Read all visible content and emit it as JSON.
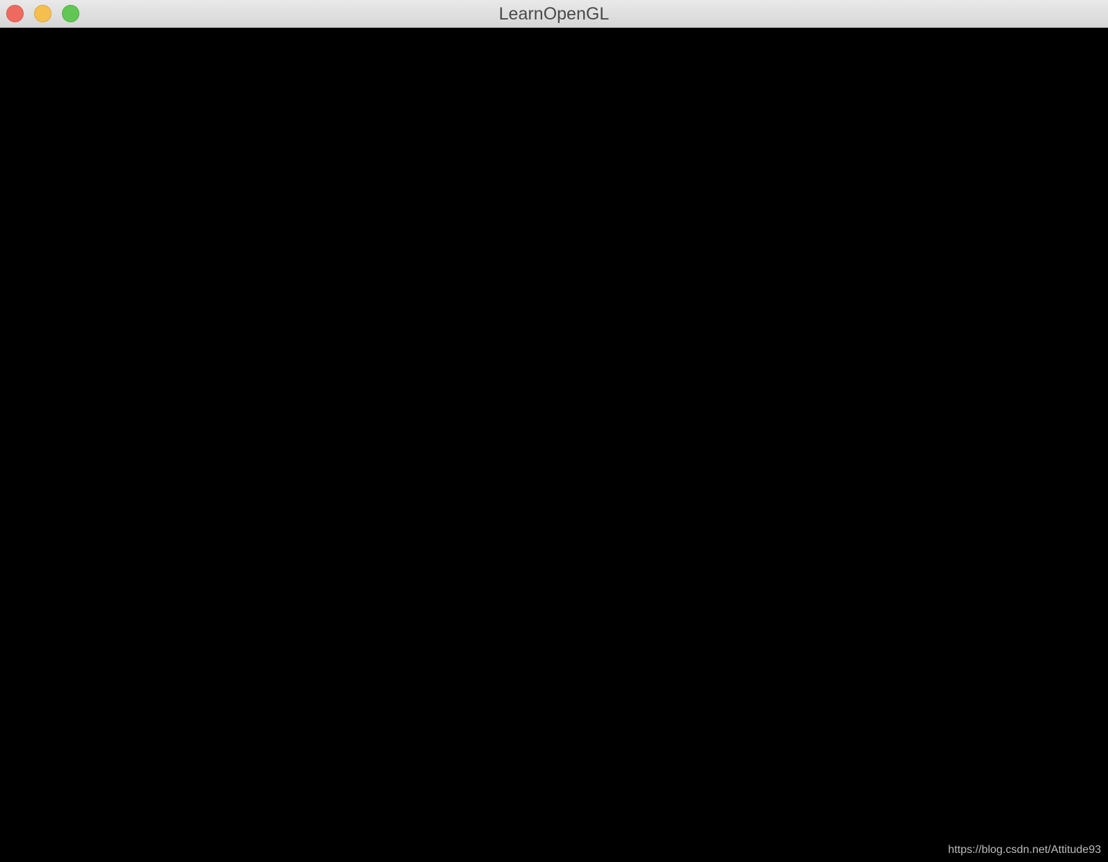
{
  "window": {
    "title": "LearnOpenGL",
    "controls": {
      "close_icon": "close-icon",
      "minimize_icon": "minimize-icon",
      "zoom_icon": "zoom-icon"
    }
  },
  "viewport": {
    "background_color": "#000000"
  },
  "watermark": {
    "text": "https://blog.csdn.net/Attitude93"
  },
  "colors": {
    "close": "#ee6a5f",
    "minimize": "#f5bf4f",
    "zoom": "#62c655"
  }
}
